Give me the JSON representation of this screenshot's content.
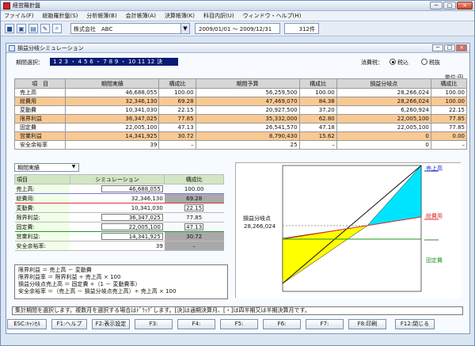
{
  "window": {
    "title": "経営羅針盤",
    "min": "─",
    "max": "□",
    "close": "×"
  },
  "menu": [
    "ファイル(F)",
    "総勘羅針盤(S)",
    "分析帳簿(B)",
    "会計帳簿(A)",
    "決算帳簿(K)",
    "科目内訳(U)",
    "ウィンドウ・ヘルプ(H)"
  ],
  "toolbar": {
    "company": "株式会社　ABC",
    "period": "2009/01/01 〜 2009/12/31",
    "count": "312件",
    "dropdown": "▼"
  },
  "inner": {
    "title": "損益分岐シミュレーション",
    "min": "─",
    "max": "□",
    "close": "×"
  },
  "controls": {
    "period_label": "期間選択：",
    "periods": "1 2 3 ・ 4 5 6 ・ 7 8 9 ・ 10 11 12 決",
    "tax_label": "消費税：",
    "tax_in": "税込",
    "tax_out": "税抜",
    "unit": "単位:円"
  },
  "main_table": {
    "headers": [
      "項　目",
      "期間実績",
      "構成比",
      "期間予算",
      "構成比",
      "損益分岐点",
      "構成比"
    ],
    "rows": [
      [
        "売上高",
        "46,688,055",
        "100.00",
        "56,259,500",
        "100.00",
        "28,266,024",
        "100.00"
      ],
      [
        "総費用",
        "32,346,130",
        "69.28",
        "47,469,070",
        "84.38",
        "28,266,024",
        "100.00"
      ],
      [
        "変動費",
        "10,341,030",
        "22.15",
        "20,927,500",
        "37.20",
        "6,260,924",
        "22.15"
      ],
      [
        "限界利益",
        "36,347,025",
        "77.85",
        "35,332,000",
        "62.80",
        "22,005,100",
        "77.85"
      ],
      [
        "固定費",
        "22,005,100",
        "47.13",
        "26,541,570",
        "47.18",
        "22,005,100",
        "77.85"
      ],
      [
        "営業利益",
        "14,341,925",
        "30.72",
        "8,790,430",
        "15.62",
        "0",
        "0.00"
      ],
      [
        "安全余裕率",
        "39",
        "–",
        "25",
        "–",
        "0",
        "–"
      ]
    ]
  },
  "simulation": {
    "dropdown": "期間実績",
    "arrow": "▼",
    "headers": [
      "項目",
      "シミュレーション",
      "構成比"
    ],
    "rows": [
      [
        "売上高:",
        "46,688,055",
        "100.00"
      ],
      [
        "総費用:",
        "32,346,130",
        "69.28"
      ],
      [
        "変動費:",
        "10,341,030",
        "22.15"
      ],
      [
        "限界利益:",
        "36,347,025",
        "77.85"
      ],
      [
        "固定費:",
        "22,005,100",
        "47.13"
      ],
      [
        "営業利益:",
        "14,341,925",
        "30.72"
      ],
      [
        "安全余裕率:",
        "39",
        "–"
      ]
    ]
  },
  "formulas": [
    "限界利益 ＝ 売上高 － 変動費",
    "限界利益率 ＝ 限界利益 ÷ 売上高 × 100",
    "損益分岐点売上高 ＝ 固定費 ÷（1 － 変動費率）",
    "安全余裕率 ＝（売上高 － 損益分岐点売上高）÷ 売上高 × 100"
  ],
  "chart": {
    "break_even_label": "損益分岐点",
    "break_even_value": "28,266,024",
    "legend_sales": "売上高",
    "legend_total_cost": "総費用",
    "legend_fixed_cost": "固定費",
    "colors": {
      "sales": "#1b2cc8",
      "total": "#e12b2b",
      "fixed": "#229522",
      "profit": "#00e5ff",
      "loss": "#ffff00"
    }
  },
  "status": "集計期間を選択します。複数月を選択する場合はﾄﾞﾗｯｸﾞします。[決]は通期決算月、[・]は四半期又は半期決算月です。",
  "fkeys": [
    "ESC:ｷｬﾝｾﾙ",
    "F1:ヘルプ",
    "F2:表示設定",
    "F3:",
    "F4:",
    "F5:",
    "F6:",
    "F7:",
    "F8:印刷",
    "F12:閉じる"
  ]
}
